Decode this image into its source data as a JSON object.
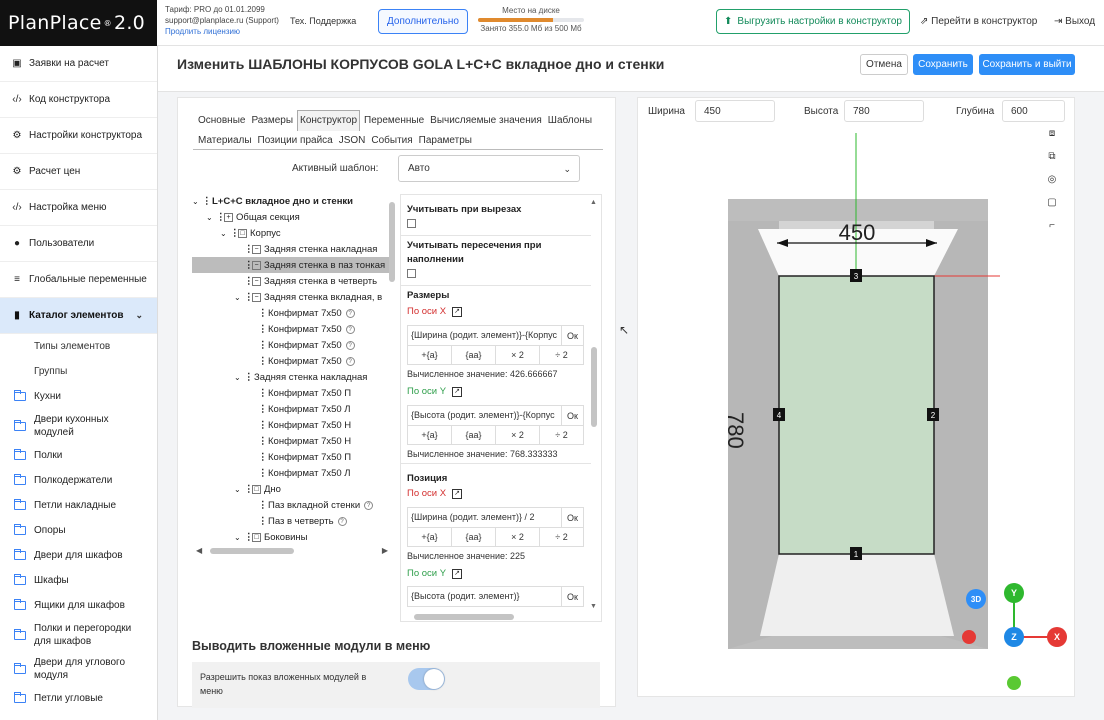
{
  "header": {
    "logo": "PlanPlace",
    "logo_suffix": "2.0",
    "tariff_line": "Тариф: PRO до 01.01.2099",
    "email_line": "support@planplace.ru (Support)",
    "renew": "Продлить лицензию",
    "support": "Тех. Поддержка",
    "more": "Дополнительно",
    "disk_title": "Место на диске",
    "disk_used": "Занято 355.0 Мб из 500 Мб",
    "disk_fraction": 0.71,
    "export": "Выгрузить настройки в конструктор",
    "goto": "Перейти в конструктор",
    "exit": "Выход"
  },
  "sidebar": {
    "items": [
      {
        "icon": "▣",
        "label": "Заявки на расчет"
      },
      {
        "icon": "‹/›",
        "label": "Код конструктора"
      },
      {
        "icon": "⚙",
        "label": "Настройки конструктора"
      },
      {
        "icon": "⚙",
        "label": "Расчет цен"
      },
      {
        "icon": "‹/›",
        "label": "Настройка меню"
      },
      {
        "icon": "●",
        "label": "Пользователи"
      },
      {
        "icon": "≡",
        "label": "Глобальные переменные"
      },
      {
        "icon": "▮",
        "label": "Каталог элементов"
      }
    ],
    "subitems": [
      "Типы элементов",
      "Группы"
    ],
    "folders": [
      "Кухни",
      "Двери кухонных модулей",
      "Полки",
      "Полкодержатели",
      "Петли накладные",
      "Опоры",
      "Двери для шкафов",
      "Шкафы",
      "Ящики для шкафов",
      "Полки и перегородки для шкафов",
      "Двери для углового модуля",
      "Петли угловые"
    ]
  },
  "page": {
    "title": "Изменить ШАБЛОНЫ КОРПУСОВ GOLA L+C+C вкладное дно и стенки",
    "cancel": "Отмена",
    "save": "Сохранить",
    "save_exit": "Сохранить и выйти"
  },
  "tabs": [
    "Основные",
    "Размеры",
    "Конструктор",
    "Переменные",
    "Вычисляемые значения",
    "Шаблоны",
    "Материалы",
    "Позиции прайса",
    "JSON",
    "События",
    "Параметры"
  ],
  "active_template": {
    "label": "Активный шаблон:",
    "value": "Авто"
  },
  "tree": [
    {
      "label": "L+C+C вкладное дно и стенки",
      "arrow": "v",
      "dot": true,
      "box": "",
      "bold": true
    },
    {
      "label": "Общая секция",
      "arrow": "v",
      "dot": true,
      "box": "+"
    },
    {
      "label": "Корпус",
      "arrow": "v",
      "dot": true,
      "box": "□"
    },
    {
      "label": "Задняя стенка накладная",
      "arrow": "",
      "dot": true,
      "box": "−"
    },
    {
      "label": "Задняя стенка в паз тонкая",
      "arrow": "",
      "dot": true,
      "box": "−",
      "sel": true
    },
    {
      "label": "Задняя стенка в четверть",
      "arrow": "",
      "dot": true,
      "box": "−"
    },
    {
      "label": "Задняя стенка вкладная, в",
      "arrow": "v",
      "dot": true,
      "box": "−"
    },
    {
      "label": "Конфирмат 7х50",
      "arrow": "",
      "dot": true,
      "box": "",
      "q": true
    },
    {
      "label": "Конфирмат 7х50",
      "arrow": "",
      "dot": true,
      "box": "",
      "q": true
    },
    {
      "label": "Конфирмат 7х50",
      "arrow": "",
      "dot": true,
      "box": "",
      "q": true
    },
    {
      "label": "Конфирмат 7х50",
      "arrow": "",
      "dot": true,
      "box": "",
      "q": true
    },
    {
      "label": "Задняя стенка накладная",
      "arrow": "v",
      "dot": true,
      "box": ""
    },
    {
      "label": "Конфирмат 7х50 П",
      "arrow": "",
      "dot": true,
      "box": ""
    },
    {
      "label": "Конфирмат 7х50 Л",
      "arrow": "",
      "dot": true,
      "box": ""
    },
    {
      "label": "Конфирмат 7х50 Н",
      "arrow": "",
      "dot": true,
      "box": ""
    },
    {
      "label": "Конфирмат 7х50 Н",
      "arrow": "",
      "dot": true,
      "box": ""
    },
    {
      "label": "Конфирмат 7х50 П",
      "arrow": "",
      "dot": true,
      "box": ""
    },
    {
      "label": "Конфирмат 7х50 Л",
      "arrow": "",
      "dot": true,
      "box": ""
    },
    {
      "label": "Дно",
      "arrow": "v",
      "dot": true,
      "box": "□"
    },
    {
      "label": "Паз вкладной стенки",
      "arrow": "",
      "dot": true,
      "box": "",
      "q": true
    },
    {
      "label": "Паз в четверть",
      "arrow": "",
      "dot": true,
      "box": "",
      "q": true
    },
    {
      "label": "Боковины",
      "arrow": "v",
      "dot": true,
      "box": "□"
    }
  ],
  "props": {
    "cut_label": "Учитывать при вырезах",
    "intersect_label": "Учитывать пересечения при наполнении",
    "sizes_title": "Размеры",
    "axis_x": "По оси X",
    "axis_y": "По оси Y",
    "size_x_formula": "{Ширина (родит. элемент)}-{Корпус",
    "size_y_formula": "{Высота (родит. элемент)}-{Корпус",
    "ok": "Ок",
    "ops": [
      "+{a}",
      "{aa}",
      "× 2",
      "÷ 2"
    ],
    "size_x_computed": "Вычисленное значение: 426.666667",
    "size_y_computed": "Вычисленное значение: 768.333333",
    "position_title": "Позиция",
    "pos_x_formula": "{Ширина (родит. элемент)} / 2",
    "pos_x_computed": "Вычисленное значение: 225",
    "pos_y_formula": "{Высота (родит. элемент)}"
  },
  "nested": {
    "title": "Выводить вложенные модули в меню",
    "label": "Разрешить показ вложенных модулей в меню",
    "enabled": true
  },
  "viewer": {
    "width_label": "Ширина",
    "width_value": "450",
    "height_label": "Высота",
    "height_value": "780",
    "depth_label": "Глубина",
    "depth_value": "600",
    "dim_width_text": "450",
    "dim_height_text": "780",
    "markers": [
      "1",
      "2",
      "3",
      "4"
    ],
    "gizmo": {
      "3d": "3D",
      "y": "Y",
      "z": "Z",
      "x": "X"
    },
    "colors": {
      "panel": "#c6dcc6",
      "frame": "#222222",
      "axis_green": "#2eb82e",
      "axis_red": "#e53935",
      "axis_blue": "#1e88e5"
    }
  }
}
